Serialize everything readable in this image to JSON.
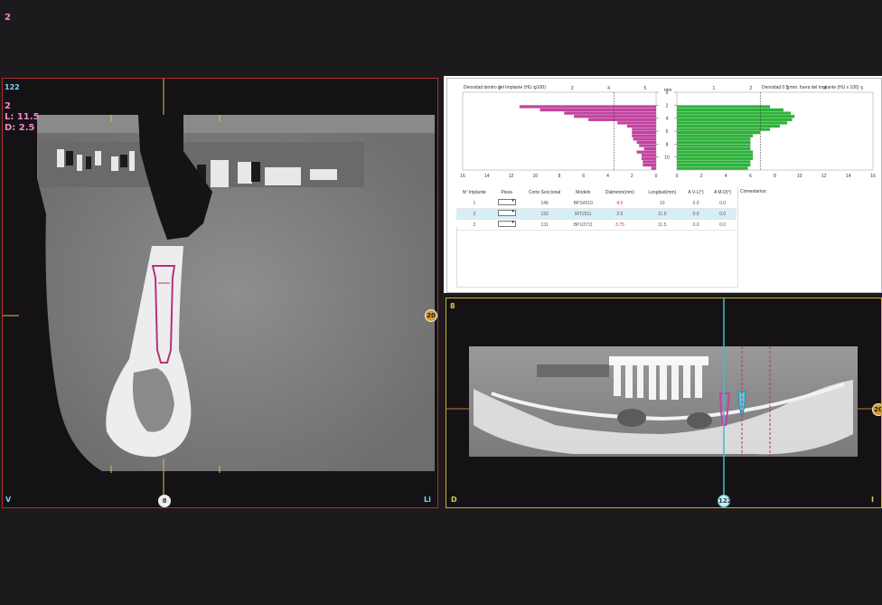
{
  "top_left_label": "2",
  "left_view": {
    "slice_label": "122",
    "implant_number": "2",
    "length_label": "L: 11.5",
    "diameter_label": "D: 2.5",
    "corner_left": "V",
    "corner_right": "Li",
    "bottom_marker": "8",
    "right_marker": "20"
  },
  "right_view": {
    "slice_label": "8",
    "corner_left": "D",
    "corner_right": "I",
    "bottom_marker": "122",
    "right_marker": "20"
  },
  "density_inside": {
    "title": "Densidad dentro del Implante (HU x 100)",
    "top_ticks": [
      "1",
      "2",
      "3",
      "4",
      "5"
    ],
    "bottom_ticks": [
      "16",
      "14",
      "12",
      "10",
      "8",
      "6",
      "4",
      "2",
      "0"
    ]
  },
  "mm_axis": {
    "unit": "mm",
    "ticks": [
      "0",
      "2",
      "4",
      "6",
      "8",
      "10"
    ]
  },
  "density_outside": {
    "title": "Densidad 0.5 mm. fuera del Implante (HU x 100)",
    "top_ticks": [
      "1",
      "2",
      "3",
      "4",
      "5"
    ],
    "bottom_ticks": [
      "0",
      "2",
      "4",
      "6",
      "8",
      "10",
      "12",
      "14",
      "16"
    ]
  },
  "chart_data": [
    {
      "type": "bar",
      "title": "Densidad dentro del Implante (HU x 100)",
      "orientation": "horizontal",
      "y_label": "mm",
      "depth_mm": [
        0.0,
        0.5,
        1.0,
        1.5,
        2.0,
        2.5,
        3.0,
        3.5,
        4.0,
        4.5,
        5.0,
        5.5,
        6.0,
        6.5,
        7.0,
        7.5,
        8.0,
        8.5,
        9.0,
        9.5,
        10.0,
        10.5,
        11.0,
        11.5
      ],
      "values": [
        0,
        0,
        0,
        0,
        11.3,
        9.6,
        7.6,
        6.8,
        5.6,
        3.2,
        2.4,
        2.0,
        2.0,
        2.0,
        1.9,
        1.6,
        1.4,
        1.0,
        1.6,
        1.2,
        1.2,
        1.1,
        1.1,
        0.4
      ],
      "x_range": [
        0,
        16
      ],
      "color": "#c2439f"
    },
    {
      "type": "bar",
      "title": "Densidad 0.5 mm. fuera del Implante (HU x 100)",
      "orientation": "horizontal",
      "y_label": "mm",
      "depth_mm": [
        0.0,
        0.5,
        1.0,
        1.5,
        2.0,
        2.5,
        3.0,
        3.5,
        4.0,
        4.5,
        5.0,
        5.5,
        6.0,
        6.5,
        7.0,
        7.5,
        8.0,
        8.5,
        9.0,
        9.5,
        10.0,
        10.5,
        11.0,
        11.5
      ],
      "values": [
        0,
        0,
        0,
        0,
        7.6,
        8.7,
        9.3,
        9.6,
        9.4,
        9.0,
        8.4,
        7.6,
        6.8,
        6.2,
        6.0,
        6.0,
        6.0,
        6.0,
        6.2,
        6.2,
        6.2,
        6.0,
        6.0,
        5.8
      ],
      "x_range": [
        0,
        16
      ],
      "color": "#2db23a"
    }
  ],
  "implant_table": {
    "headers": [
      "Nº Implante",
      "Pieza",
      "Corte Seccional",
      "Modelo",
      "Diámetro(mm)",
      "Longitud(mm)",
      "A V-L(°)",
      "A M-D(°)"
    ],
    "rows": [
      {
        "n": "1",
        "corte": "146",
        "modelo": "BPS4510",
        "diam": "4.5",
        "long": "10",
        "avl": "0.0",
        "amd": "0.0"
      },
      {
        "n": "2",
        "corte": "122",
        "modelo": "IRT2511",
        "diam": "2.5",
        "long": "11.5",
        "avl": "0.0",
        "amd": "0.0"
      },
      {
        "n": "3",
        "corte": "131",
        "modelo": "BPU3711",
        "diam": "3.75",
        "long": "11.5",
        "avl": "0.0",
        "amd": "0.0"
      }
    ],
    "comments_label": "Comentarios:"
  },
  "colors": {
    "left_frame": "#b82a2a",
    "right_frame": "#c8b228",
    "marker_line": "#d8c24a",
    "inside_bar": "#c2439f",
    "outside_bar": "#2db23a",
    "selected_row": "#d6eef6"
  }
}
